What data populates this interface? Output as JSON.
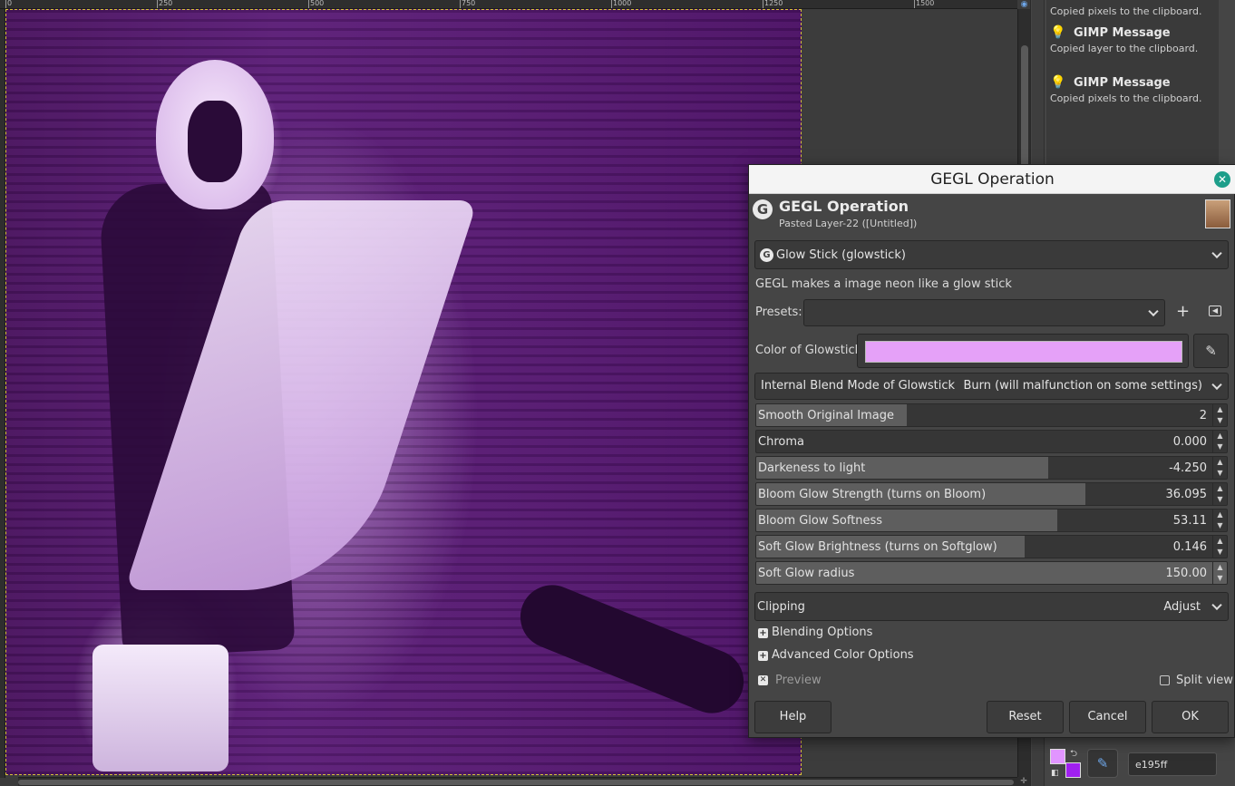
{
  "ruler": {
    "labels": [
      "0",
      "250",
      "500",
      "750",
      "1000",
      "1250",
      "1500"
    ]
  },
  "messages": [
    {
      "title": "",
      "body": "Copied pixels to the clipboard."
    },
    {
      "title": "GIMP Message",
      "body": "Copied layer to the clipboard."
    },
    {
      "title": "GIMP Message",
      "body": "Copied pixels to the clipboard."
    }
  ],
  "colors": {
    "foreground": "#e195ff",
    "background": "#a020f0",
    "hex_value": "e195ff"
  },
  "dialog": {
    "window_title": "GEGL Operation",
    "header_title": "GEGL Operation",
    "header_subtitle": "Pasted Layer-22 ([Untitled])",
    "operation": "Glow Stick (glowstick)",
    "description": "GEGL makes a image neon like a glow stick",
    "presets_label": "Presets:",
    "presets_value": "",
    "color_label": "Color of Glowstick",
    "color_value": "#e5a1f8",
    "blend_label": "Internal Blend Mode of Glowstick",
    "blend_value": "Burn (will malfunction on some settings)",
    "sliders": [
      {
        "label": "Smooth Original Image",
        "value": "2",
        "fill": 0.32
      },
      {
        "label": "Chroma",
        "value": "0.000",
        "fill": 0.0
      },
      {
        "label": "Darkeness to light",
        "value": "-4.250",
        "fill": 0.62
      },
      {
        "label": "Bloom Glow Strength (turns on Bloom)",
        "value": "36.095",
        "fill": 0.7
      },
      {
        "label": "Bloom Glow Softness",
        "value": "53.11",
        "fill": 0.64
      },
      {
        "label": "Soft Glow Brightness (turns on Softglow)",
        "value": "0.146",
        "fill": 0.57
      },
      {
        "label": "Soft Glow radius",
        "value": "150.00",
        "fill": 1.0
      }
    ],
    "clipping_label": "Clipping",
    "clipping_value": "Adjust",
    "blending_options": "Blending Options",
    "advanced_color_options": "Advanced Color Options",
    "preview_label": "Preview",
    "split_view_label": "Split view",
    "buttons": {
      "help": "Help",
      "reset": "Reset",
      "cancel": "Cancel",
      "ok": "OK"
    }
  }
}
